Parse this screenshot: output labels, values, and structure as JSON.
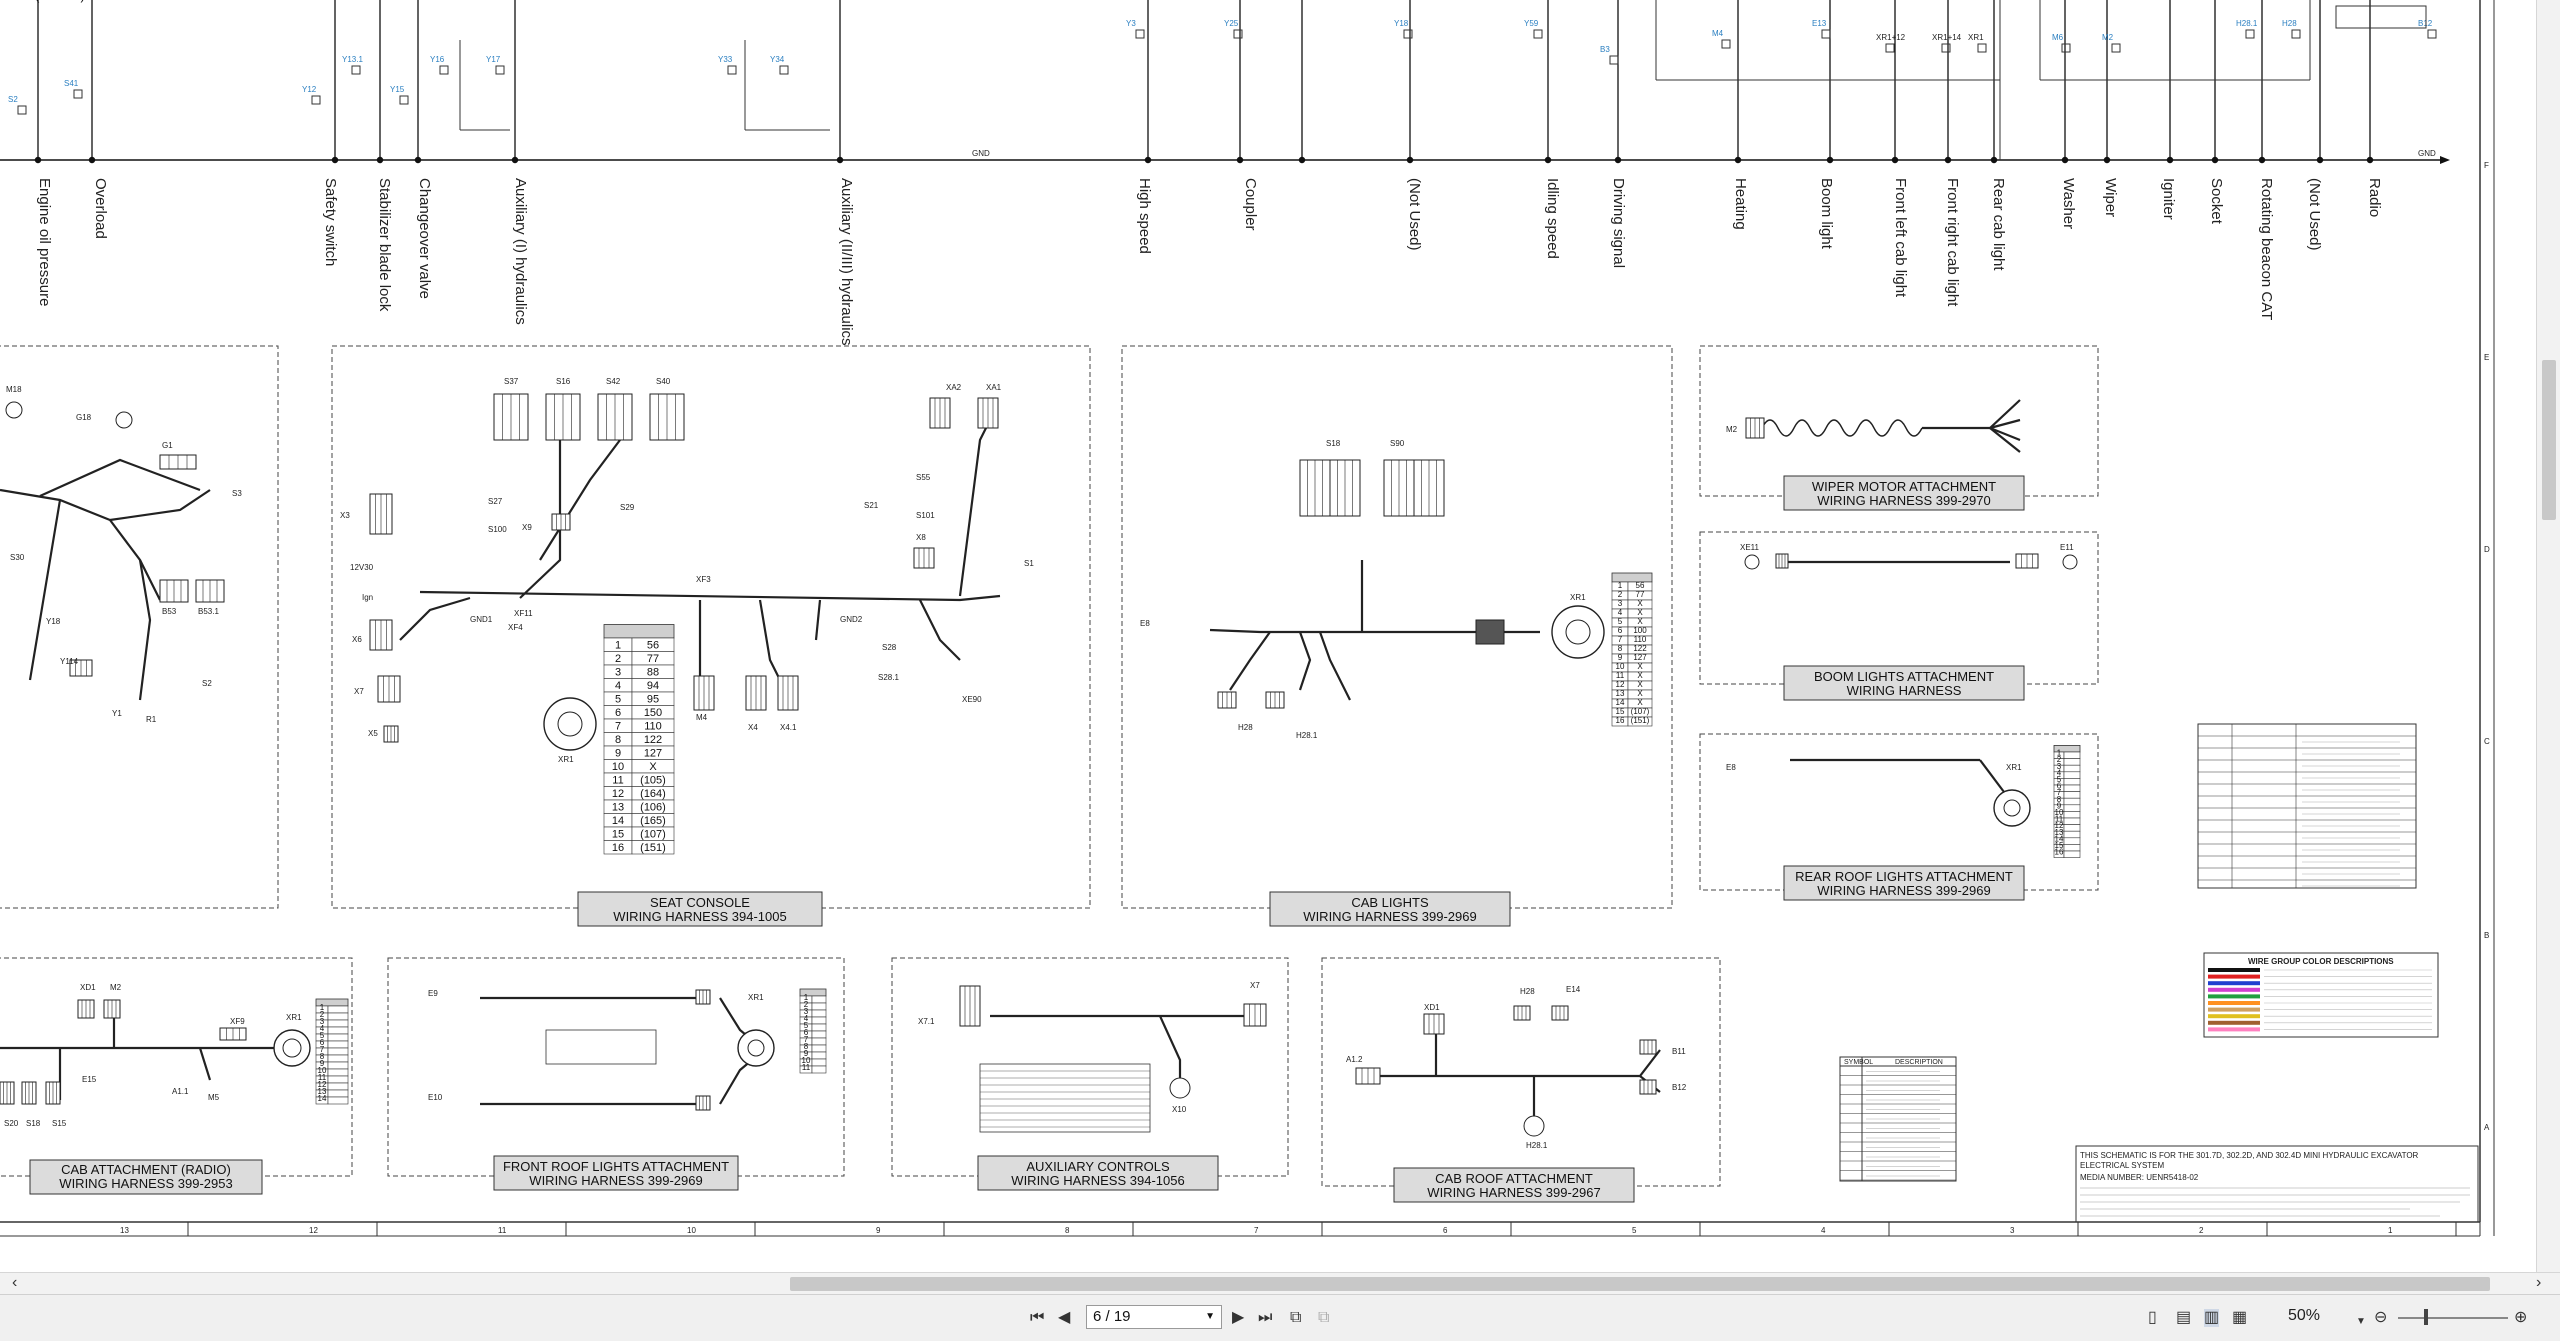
{
  "toolbar": {
    "page_input": "6 / 19",
    "zoom": "50%"
  },
  "schematic": {
    "gnd_label": "GND",
    "row_letters": [
      "F",
      "E",
      "D",
      "C",
      "B",
      "A"
    ],
    "column_numbers": [
      "13",
      "12",
      "11",
      "10",
      "9",
      "8",
      "7",
      "6",
      "5",
      "4",
      "3",
      "2",
      "1"
    ],
    "circuit_labels": [
      "Engine oil pressure",
      "Overload",
      "Safety switch",
      "Stabilizer blade lock",
      "Changeover valve",
      "Auxiliary (I) hydraulics",
      "Auxiliary (II/III) hydraulics",
      "High speed",
      "Coupler",
      "(Not Used)",
      "Idling speed",
      "Driving signal",
      "Heating",
      "Boom light",
      "Front left cab light",
      "Front right cab light",
      "Rear cab light",
      "Washer",
      "Wiper",
      "Igniter",
      "Socket",
      "Rotating beacon CAT",
      "(Not Used)",
      "Radio"
    ],
    "top_components": [
      "S2",
      "S41",
      "Y12",
      "Y13.1",
      "Y15",
      "Y16",
      "Y17",
      "Y33",
      "Y34",
      "Y3",
      "Y25",
      "Y18",
      "Y59",
      "B3",
      "M4",
      "E13",
      "XR1+12",
      "XR1+14",
      "XR1",
      "M6",
      "M2",
      "H28.1",
      "H28",
      "B12"
    ],
    "panels": {
      "seat_console": {
        "title1": "SEAT CONSOLE",
        "title2": "WIRING HARNESS 394-1005",
        "table": [
          [
            "1",
            "56"
          ],
          [
            "2",
            "77"
          ],
          [
            "3",
            "88"
          ],
          [
            "4",
            "94"
          ],
          [
            "5",
            "95"
          ],
          [
            "6",
            "150"
          ],
          [
            "7",
            "110"
          ],
          [
            "8",
            "122"
          ],
          [
            "9",
            "127"
          ],
          [
            "10",
            "X"
          ],
          [
            "11",
            "(105)"
          ],
          [
            "12",
            "(164)"
          ],
          [
            "13",
            "(106)"
          ],
          [
            "14",
            "(165)"
          ],
          [
            "15",
            "(107)"
          ],
          [
            "16",
            "(151)"
          ]
        ],
        "labels": [
          "S37",
          "S16",
          "S42",
          "S40",
          "S27",
          "S100",
          "X9",
          "S29",
          "S55",
          "S101",
          "S21",
          "X8",
          "XA2",
          "XA1",
          "S1",
          "X3",
          "12V30",
          "Ign",
          "GND1",
          "XF4",
          "XF11",
          "XF3",
          "GND2",
          "S28",
          "S28.1",
          "XE90",
          "X6",
          "X7",
          "X5",
          "XR1",
          "M4",
          "X4",
          "X4.1"
        ]
      },
      "cab_lights": {
        "title1": "CAB LIGHTS",
        "title2": "WIRING HARNESS 399-2969",
        "table": [
          [
            "1",
            "56"
          ],
          [
            "2",
            "77"
          ],
          [
            "3",
            "X"
          ],
          [
            "4",
            "X"
          ],
          [
            "5",
            "X"
          ],
          [
            "6",
            "100"
          ],
          [
            "7",
            "110"
          ],
          [
            "8",
            "122"
          ],
          [
            "9",
            "127"
          ],
          [
            "10",
            "X"
          ],
          [
            "11",
            "X"
          ],
          [
            "12",
            "X"
          ],
          [
            "13",
            "X"
          ],
          [
            "14",
            "X"
          ],
          [
            "15",
            "(107)"
          ],
          [
            "16",
            "(151)"
          ]
        ],
        "labels": [
          "S18",
          "S90",
          "E8",
          "H28",
          "H28.1",
          "XR1"
        ]
      },
      "wiper_motor": {
        "title1": "WIPER MOTOR  ATTACHMENT",
        "title2": "WIRING HARNESS 399-2970",
        "labels": [
          "M2"
        ]
      },
      "boom_lights": {
        "title1": "BOOM LIGHTS ATTACHMENT",
        "title2": "WIRING HARNESS",
        "labels": [
          "XE11",
          "E11"
        ]
      },
      "rear_roof": {
        "title1": "REAR ROOF LIGHTS ATTACHMENT",
        "title2": "WIRING HARNESS 399-2969",
        "labels": [
          "E8",
          "XR1"
        ]
      },
      "left_engine": {
        "labels": [
          "M18",
          "G18",
          "G1",
          "S3",
          "S30",
          "Y18",
          "Y114",
          "B53",
          "B53.1",
          "S2",
          "Y1",
          "R1"
        ]
      },
      "cab_attachment": {
        "title1": "CAB ATTACHMENT (RADIO)",
        "title2": "WIRING HARNESS 399-2953",
        "labels": [
          "XD1",
          "M2",
          "XF9",
          "XR1",
          "E15",
          "A1.1",
          "M5",
          "S20",
          "S18",
          "S15"
        ]
      },
      "front_roof": {
        "title1": "FRONT ROOF LIGHTS ATTACHMENT",
        "title2": "WIRING HARNESS 399-2969",
        "labels": [
          "E9",
          "E10",
          "XR1"
        ]
      },
      "aux_controls": {
        "title1": "AUXILIARY CONTROLS",
        "title2": "WIRING HARNESS 394-1056",
        "labels": [
          "X7.1",
          "X7",
          "X10"
        ]
      },
      "cab_roof": {
        "title1": "CAB ROOF  ATTACHMENT",
        "title2": "WIRING HARNESS 399-2967",
        "labels": [
          "XD1",
          "H28",
          "E14",
          "A1.2",
          "B11",
          "B12",
          "H28.1"
        ]
      }
    },
    "wire_group_title": "WIRE GROUP COLOR DESCRIPTIONS",
    "wire_group_colors": [
      "#111111",
      "#e02020",
      "#2040d0",
      "#d040d0",
      "#20a040",
      "#ff9020",
      "#d0a060",
      "#e0c020",
      "#a06030",
      "#ff80c0"
    ],
    "symbol_title": "DESCRIPTION",
    "note_lines": [
      "THIS SCHEMATIC IS FOR THE 301.7D, 302.2D, AND 302.4D MINI HYDRAULIC EXCAVATOR",
      "ELECTRICAL SYSTEM",
      "MEDIA NUMBER: UENR5418-02"
    ]
  }
}
